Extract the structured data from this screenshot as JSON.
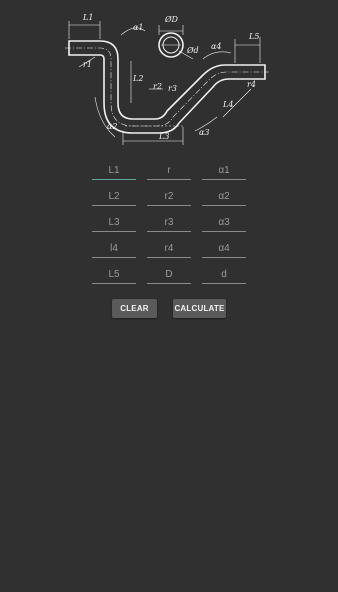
{
  "drawing": {
    "labels": {
      "L1": "L1",
      "L2": "L2",
      "L3": "L3",
      "L4": "L4",
      "L5": "L5",
      "r1": "r1",
      "r2": "r2",
      "r3": "r3",
      "r4": "r4",
      "a1": "α1",
      "a2": "α2",
      "a3": "α3",
      "a4": "α4",
      "D": "ØD",
      "d": "Ød"
    }
  },
  "fields": [
    {
      "placeholder": "L1"
    },
    {
      "placeholder": "r"
    },
    {
      "placeholder": "α1"
    },
    {
      "placeholder": "L2"
    },
    {
      "placeholder": "r2"
    },
    {
      "placeholder": "α2"
    },
    {
      "placeholder": "L3"
    },
    {
      "placeholder": "r3"
    },
    {
      "placeholder": "α3"
    },
    {
      "placeholder": "l4"
    },
    {
      "placeholder": "r4"
    },
    {
      "placeholder": "α4"
    },
    {
      "placeholder": "L5"
    },
    {
      "placeholder": "D"
    },
    {
      "placeholder": "d"
    }
  ],
  "buttons": {
    "clear": "CLEAR",
    "calculate": "CALCULATE"
  }
}
